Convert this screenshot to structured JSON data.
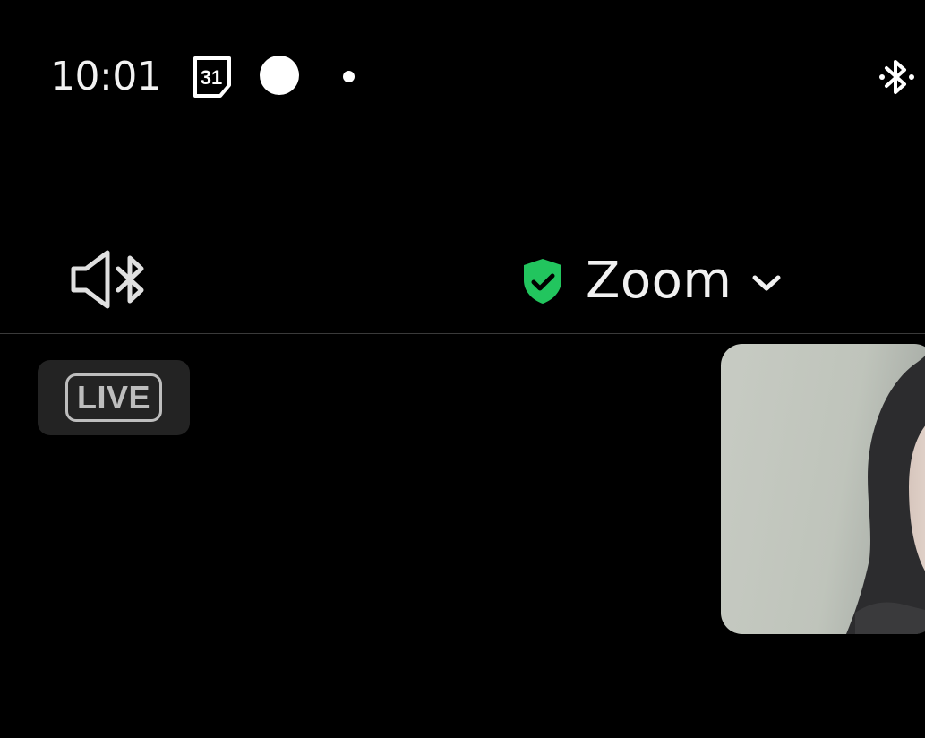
{
  "status_bar": {
    "time": "10:01",
    "calendar_day": "31",
    "icons": [
      "calendar-icon",
      "circle-icon",
      "dot-icon",
      "bluetooth-icon"
    ]
  },
  "toolbar": {
    "audio_output_icon": "speaker-bluetooth-icon",
    "meeting_title": "Zoom",
    "secure_icon": "shield-check-icon",
    "dropdown_icon": "chevron-down-icon"
  },
  "meeting": {
    "live_label": "LIVE"
  },
  "colors": {
    "background": "#000000",
    "secure_green": "#22c55e",
    "live_badge_bg": "#232323",
    "live_badge_fg": "#bdbdbd"
  }
}
